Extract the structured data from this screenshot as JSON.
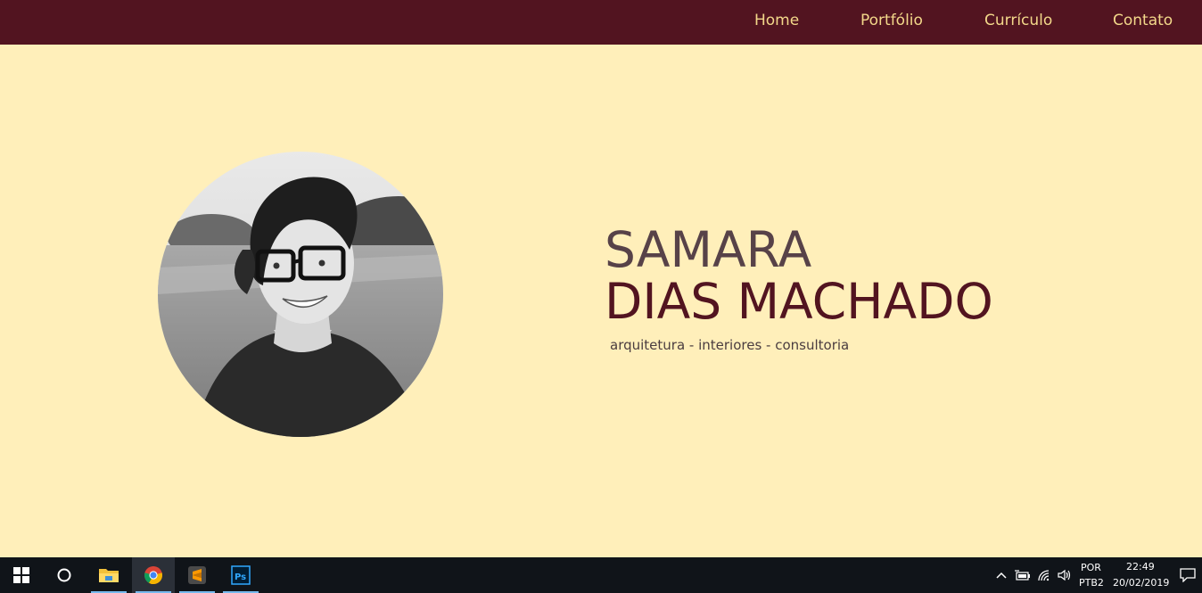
{
  "nav": {
    "items": [
      {
        "label": "Home"
      },
      {
        "label": "Portfólio"
      },
      {
        "label": "Currículo"
      },
      {
        "label": "Contato"
      }
    ]
  },
  "hero": {
    "first_name": "SAMARA",
    "last_name": "DIAS MACHADO",
    "tagline": "arquitetura - interiores - consultoria"
  },
  "colors": {
    "nav_background": "#521420",
    "nav_text": "#F3D88A",
    "page_background": "#FFEFBA",
    "first_name": "#574248",
    "last_name": "#521420"
  },
  "taskbar": {
    "apps": [
      {
        "icon": "windows-start-icon"
      },
      {
        "icon": "cortana-search-icon"
      },
      {
        "icon": "file-explorer-icon"
      },
      {
        "icon": "chrome-icon"
      },
      {
        "icon": "sublime-text-icon"
      },
      {
        "icon": "photoshop-icon"
      }
    ],
    "tray": {
      "language_top": "POR",
      "language_bottom": "PTB2",
      "time": "22:49",
      "date": "20/02/2019"
    }
  }
}
